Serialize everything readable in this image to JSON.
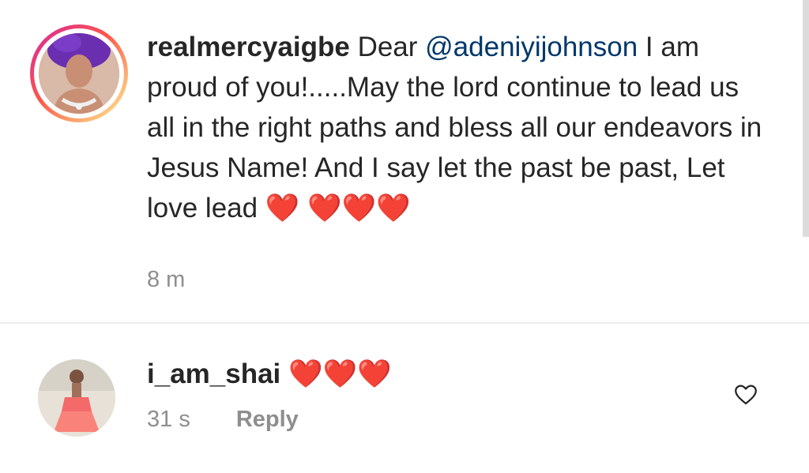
{
  "caption": {
    "username": "realmercyaigbe",
    "text_before_mention": "Dear ",
    "mention": "@adeniyijohnson",
    "text_after_mention": " I am proud of you!.....May the lord continue to lead us all in the right paths and bless all our endeavors in Jesus Name! And I say let the past be past, Let love lead ",
    "hearts": "❤️ ❤️❤️❤️",
    "time": "8 m"
  },
  "comment": {
    "username": "i_am_shai",
    "text": "❤️❤️❤️",
    "time": "31 s",
    "reply_label": "Reply"
  },
  "icons": {
    "like": "heart-outline-icon"
  },
  "colors": {
    "text": "#262626",
    "mention": "#00376b",
    "meta": "#8e8e8e",
    "heart": "#ed1c24"
  }
}
